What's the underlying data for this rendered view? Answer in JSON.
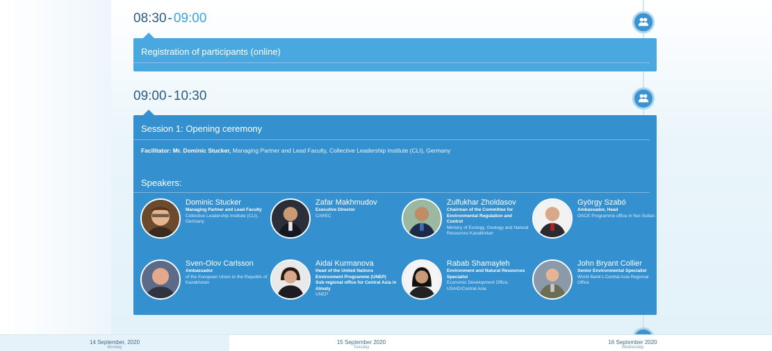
{
  "slots": [
    {
      "time_start": "08:30",
      "time_end": "09:00",
      "title": "Registration of participants (online)"
    },
    {
      "time_start": "09:00",
      "time_end": "10:30",
      "title": "Session 1: Opening ceremony",
      "facilitator_label": "Facilitator: Mr. Dominic Stucker,",
      "facilitator_text": " Managing Partner and Lead Faculty, Collective Leadership Institute (CLI), Germany",
      "speakers_label": "Speakers:",
      "speakers": [
        {
          "name": "Dominic Stucker",
          "role": "Managing Partner and Lead Faculty",
          "org": "Collective Leadership Institute (CLI), Germany"
        },
        {
          "name": "Zafar Makhmudov",
          "role": "Executive Director",
          "org": "CAREC"
        },
        {
          "name": "Zulfukhar Zholdasov",
          "role": "Chairman of the Committee for Environmental Regulation and Control",
          "org": "Ministry of Ecology, Geology and Natural Resources Kazakhstan"
        },
        {
          "name": "György Szabó",
          "role": "Ambassador, Head",
          "org": "OSCE Programme office in Nur-Sultan"
        },
        {
          "name": "Sven-Olov Carlsson",
          "role": "Ambassador",
          "org": "of the European Union to the Republic of Kazakhstan"
        },
        {
          "name": "Aidai Kurmanova",
          "role": "Head of the United Nations Environment Programme (UNEP) Sub-regional office for Central Asia in Almaty",
          "org": "UNEP"
        },
        {
          "name": "Rabab Shamayleh",
          "role": "Environment and Natural Resources Specialist",
          "org": "Economic Development Office, USAID/Central Asia"
        },
        {
          "name": "John Bryant Collier",
          "role": "Senior Environmental Specialist",
          "org": "World Bank's Central Asia Regional Office"
        }
      ]
    }
  ],
  "day_tabs": [
    {
      "date": "14 September, 2020",
      "day": "Monday"
    },
    {
      "date": "15 September 2020",
      "day": "Tuesday"
    },
    {
      "date": "16 September 2020",
      "day": "Wednesday"
    }
  ],
  "icons": {
    "badge": "people-icon"
  },
  "colors": {
    "card_light": "#4aa8e0",
    "card_dark": "#3590cf",
    "badge": "#3c93cf",
    "time_accent": "#3aa2dc"
  }
}
